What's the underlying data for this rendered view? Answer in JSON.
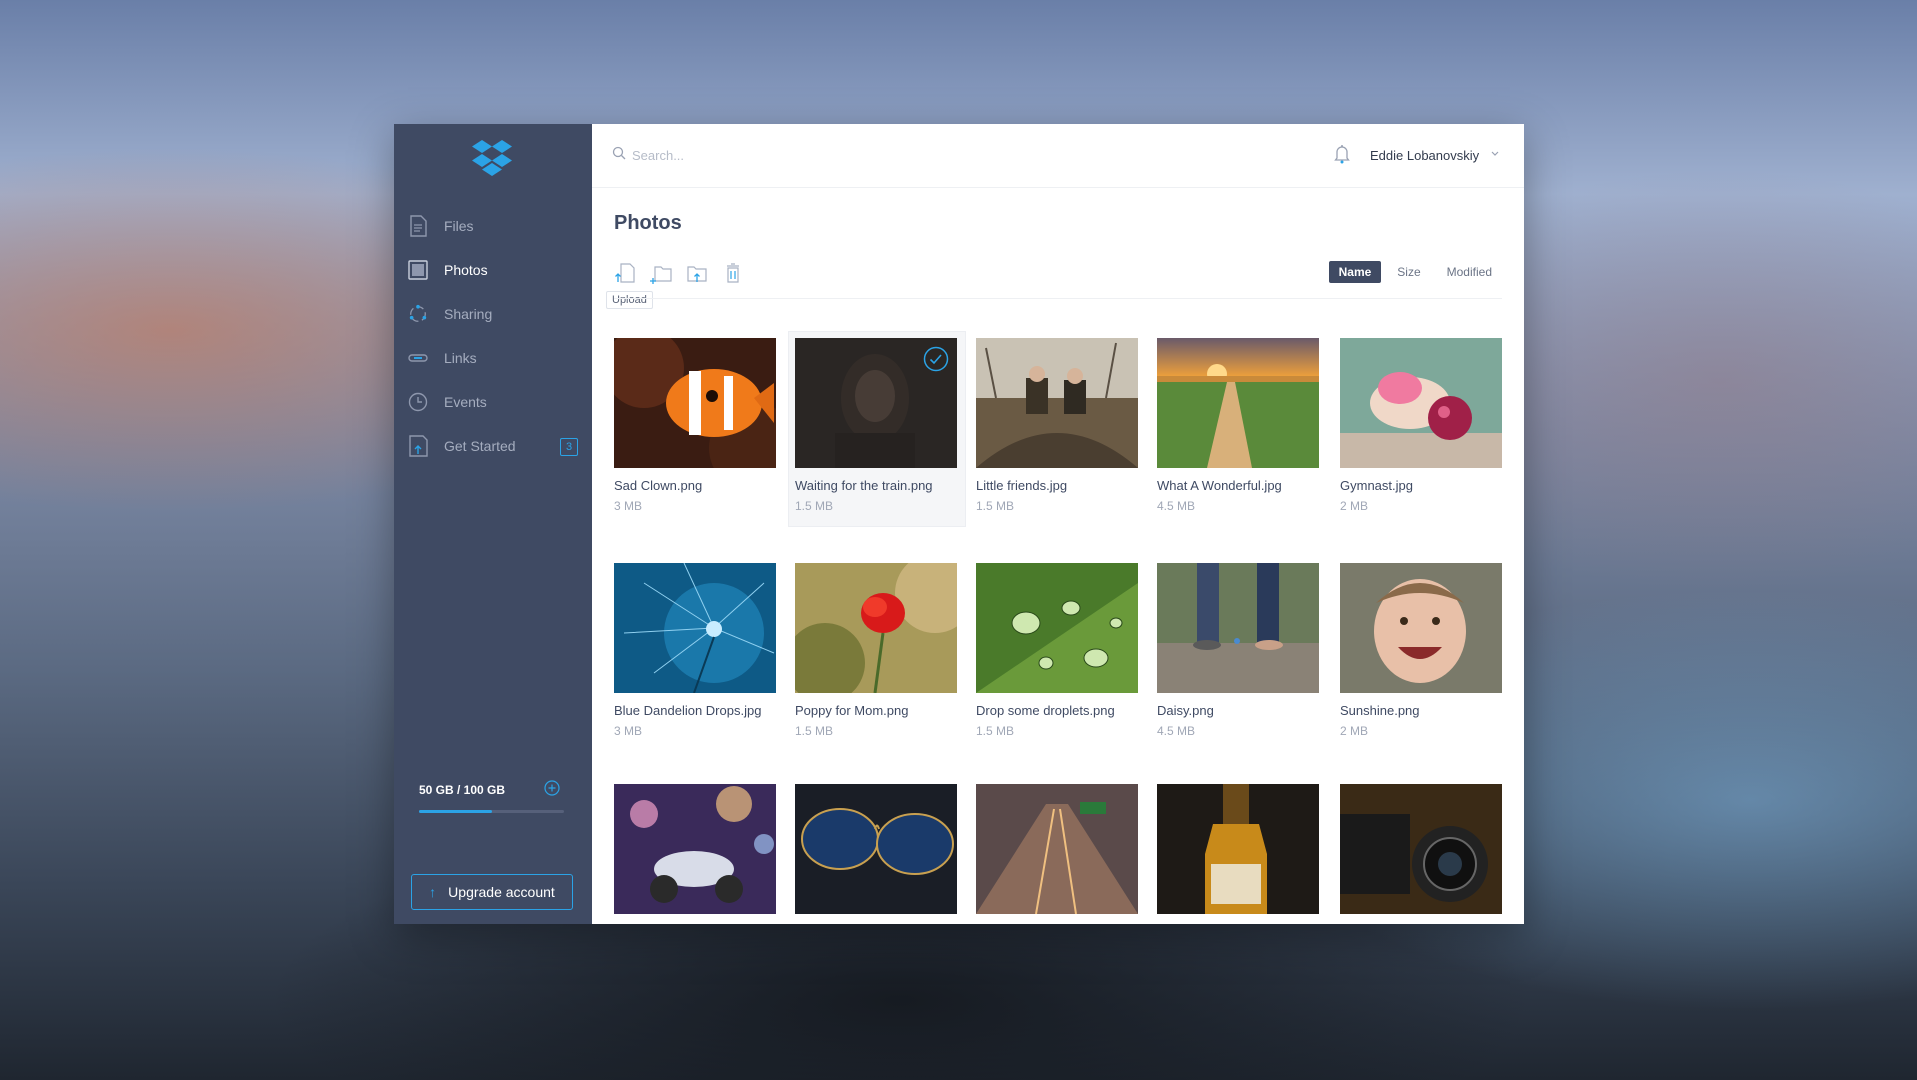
{
  "sidebar": {
    "items": [
      {
        "label": "Files",
        "icon": "file-icon"
      },
      {
        "label": "Photos",
        "icon": "photo-icon",
        "active": true
      },
      {
        "label": "Sharing",
        "icon": "sharing-icon"
      },
      {
        "label": "Links",
        "icon": "link-icon"
      },
      {
        "label": "Events",
        "icon": "clock-icon"
      },
      {
        "label": "Get Started",
        "icon": "get-started-icon",
        "badge": "3"
      }
    ],
    "storage": {
      "label": "50 GB / 100 GB",
      "used_fraction": 0.5
    },
    "upgrade_label": "Upgrade account"
  },
  "header": {
    "search_placeholder": "Search...",
    "user_name": "Eddie Lobanovskiy"
  },
  "main": {
    "title": "Photos",
    "tooltip": "Upload",
    "sort": {
      "name": "Name",
      "size": "Size",
      "modified": "Modified",
      "active": "Name"
    },
    "photos": [
      {
        "name": "Sad Clown.png",
        "size": "3 MB"
      },
      {
        "name": "Waiting for the train.png",
        "size": "1.5 MB",
        "selected": true
      },
      {
        "name": "Little friends.jpg",
        "size": "1.5 MB"
      },
      {
        "name": "What A Wonderful.jpg",
        "size": "4.5 MB"
      },
      {
        "name": "Gymnast.jpg",
        "size": "2 MB"
      },
      {
        "name": "Blue Dandelion Drops.jpg",
        "size": "3 MB"
      },
      {
        "name": "Poppy for Mom.png",
        "size": "1.5 MB"
      },
      {
        "name": "Drop some droplets.png",
        "size": "1.5 MB"
      },
      {
        "name": "Daisy.png",
        "size": "4.5 MB"
      },
      {
        "name": "Sunshine.png",
        "size": "2 MB"
      }
    ]
  },
  "colors": {
    "accent": "#2ba3e6",
    "sidebar": "#3f4a63"
  }
}
